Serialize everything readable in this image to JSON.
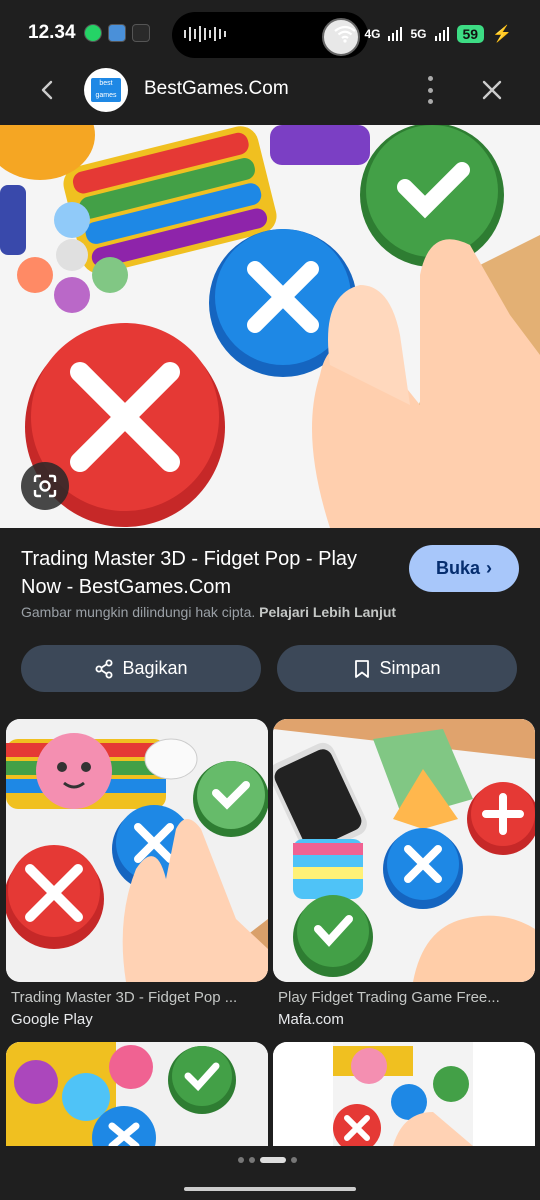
{
  "status_bar": {
    "time": "12.34",
    "network_4g": "4G",
    "network_5g": "5G",
    "battery": "59"
  },
  "header": {
    "site_name": "BestGames.Com",
    "logo_text": "best games"
  },
  "result": {
    "title": "Trading Master 3D - Fidget Pop - Play Now - BestGames.Com",
    "open_label": "Buka",
    "copyright_text": "Gambar mungkin dilindungi hak cipta.",
    "learn_more": "Pelajari Lebih Lanjut",
    "share_label": "Bagikan",
    "save_label": "Simpan"
  },
  "related": [
    {
      "title": "Trading Master 3D - Fidget Pop ...",
      "source": "Google Play"
    },
    {
      "title": "Play Fidget Trading Game Free...",
      "source": "Mafa.com"
    }
  ],
  "colors": {
    "accent": "#a8c7fa",
    "button_bg": "#3c4858",
    "background": "#1f1f1f"
  }
}
